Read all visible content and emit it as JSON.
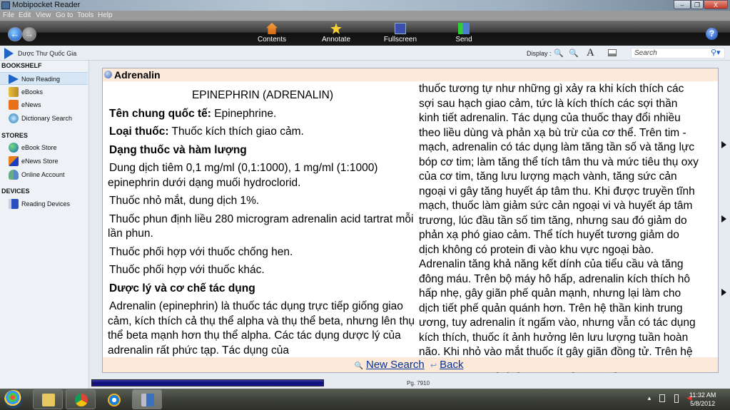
{
  "window": {
    "title": "Mobipocket Reader",
    "controls": {
      "minimize": "–",
      "restore": "❐",
      "close": "X"
    }
  },
  "menu": [
    "File",
    "Edit",
    "View",
    "Go to",
    "Tools",
    "Help"
  ],
  "toolbar": {
    "buttons": [
      {
        "label": "Contents",
        "icon": "home-icon"
      },
      {
        "label": "Annotate",
        "icon": "star-icon"
      },
      {
        "label": "Fullscreen",
        "icon": "fullscreen-icon"
      },
      {
        "label": "Send",
        "icon": "send-device-icon"
      }
    ],
    "help": "?"
  },
  "subbar": {
    "book_title": "Dược Thư Quốc Gia",
    "display_label": "Display :",
    "font_icon": "A",
    "search_placeholder": "Search"
  },
  "sidebar": {
    "sections": [
      {
        "title": "BOOKSHELF",
        "items": [
          {
            "label": "Now Reading",
            "icon": "play-icon",
            "selected": true
          },
          {
            "label": "eBooks",
            "icon": "folder-icon"
          },
          {
            "label": "eNews",
            "icon": "rss-icon"
          },
          {
            "label": "Dictionary Search",
            "icon": "magnifier-icon"
          }
        ]
      },
      {
        "title": "STORES",
        "items": [
          {
            "label": "eBook Store",
            "icon": "globe-icon"
          },
          {
            "label": "eNews Store",
            "icon": "rss-monitor-icon"
          },
          {
            "label": "Online Account",
            "icon": "users-icon"
          }
        ]
      },
      {
        "title": "DEVICES",
        "items": [
          {
            "label": "Reading Devices",
            "icon": "device-icon"
          }
        ]
      }
    ]
  },
  "content": {
    "heading": "Adrenalin",
    "left": [
      "EPINEPHRIN (ADRENALIN)",
      {
        "b": "Tên chung quốc tế:",
        "t": " Epinephrine."
      },
      {
        "b": "Loại thuốc:",
        "t": " Thuốc kích thích giao cảm."
      },
      {
        "b": "Dạng thuốc và hàm lượng",
        "t": ""
      },
      "Dung dịch tiêm 0,1 mg/ml (0,1:1000), 1 mg/ml (1:1000) epinephrin dưới dạng muối hydroclorid.",
      "Thuốc nhỏ mắt, dung dịch 1%.",
      "Thuốc phun định liều 280 microgram adrenalin acid tartrat mỗi lần phun.",
      "Thuốc phối hợp với thuốc chống hen.",
      "Thuốc phối hợp với thuốc khác.",
      {
        "b": "Dược lý và cơ chế tác dụng",
        "t": ""
      },
      "Adrenalin (epinephrin) là thuốc tác dụng trực tiếp giống giao cảm, kích thích cả thụ thể alpha và thụ thể beta, nhưng lên thụ thể beta mạnh hơn thụ thể alpha. Các tác dụng dược lý của adrenalin rất phức tạp. Tác dụng của"
    ],
    "right": [
      "thuốc tương tự như những gì xảy ra khi kích thích các",
      "sợi sau hạch giao cảm, tức là kích thích các sợi thần",
      "kinh tiết adrenalin. Tác dụng của thuốc thay đổi nhiều",
      "theo liều dùng và phản xạ bù trừ của cơ thể. Trên tim -",
      "mạch, adrenalin có tác dụng làm tăng tần số và tăng lực",
      "bóp cơ tim; làm tăng thể tích tâm thu và mức tiêu thụ oxy",
      "của cơ tim, tăng lưu lượng mạch vành, tăng sức cản",
      "ngoại vi gây tăng huyết áp tâm thu. Khi được truyền tĩnh",
      "mạch, thuốc làm giảm sức cản ngoại vi và huyết áp tâm",
      "trương, lúc đầu tần số tim tăng, nhưng sau đó giảm do",
      "phản xạ phó giao cảm. Thể tích huyết tương giảm do",
      "dịch không có protein đi vào khu vực ngoại bào.",
      "Adrenalin tăng khả năng kết dính của tiểu cầu và tăng",
      "đông máu. Trên bộ máy hô hấp, adrenalin kích thích hô",
      "hấp nhẹ, gây giãn phế quản mạnh, nhưng lại làm cho",
      "dịch tiết phế quản quánh hơn. Trên hệ thần kinh trung",
      "ương, tuy adrenalin ít ngấm vào, nhưng vẫn có tác dụng",
      "kích thích, thuốc ít ảnh hưởng lên lưu lượng tuần hoàn",
      "não. Khi nhỏ vào mắt thuốc ít gây giãn đồng tử. Trên hệ",
      "tiêu hóa, thuốc gây giảm trương lực và giảm bài tiết của"
    ],
    "links": {
      "new_search": "New Search",
      "back": "Back"
    }
  },
  "status": {
    "page": "Pg. 7910",
    "progress_fraction": 0.37,
    "progress_color": "#0c0c78"
  },
  "taskbar": {
    "apps": [
      "start-orb",
      "file-explorer",
      "chrome",
      "internet-explorer",
      "mobipocket-reader"
    ],
    "time": "11:32 AM",
    "date": "5/8/2012"
  },
  "colors": {
    "panel_header": "#fde9d9",
    "link": "#003399",
    "selected_item": "#d6e6f5"
  }
}
